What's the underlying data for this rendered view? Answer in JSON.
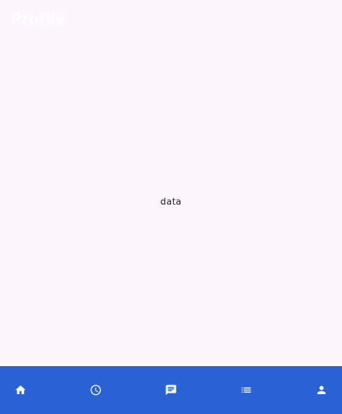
{
  "app_bar": {
    "title": "Profile"
  },
  "content": {
    "text": "data"
  },
  "bottom_nav": {
    "background": "#2a62d4",
    "items": [
      {
        "icon": "home-icon"
      },
      {
        "icon": "clock-icon"
      },
      {
        "icon": "chat-icon"
      },
      {
        "icon": "list-icon"
      },
      {
        "icon": "person-icon"
      }
    ]
  }
}
